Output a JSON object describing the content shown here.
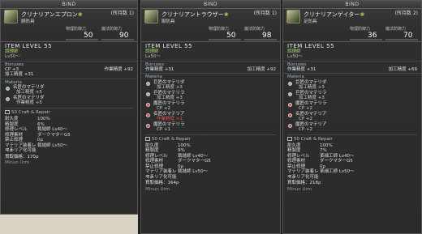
{
  "panels": [
    {
      "bind": "BIND",
      "name": "クリナリアンエプロン",
      "hq_mark": "❀",
      "owned": "(所持数 1)",
      "category": "胴防具",
      "stats": [
        {
          "label": "物理防御力",
          "value": "50"
        },
        {
          "label": "魔法防御力",
          "value": "90"
        }
      ],
      "item_level": "ITEM LEVEL 55",
      "job": "調理師",
      "level": "Lv50～",
      "bonuses_title": "Bonuses",
      "bonuses": [
        [
          "CP +3",
          "作業精度 +92"
        ],
        [
          "加工精度 +31",
          ""
        ]
      ],
      "materia_title": "Materia",
      "materia": [
        {
          "name": "名匠のマテリダ",
          "effect": "加工精度 +5",
          "color": "green",
          "bad": false
        },
        {
          "name": "名匠のマテリダ",
          "effect": "作業精度 +5",
          "color": "green",
          "bad": false
        }
      ],
      "craft": "50 Craft & Repair",
      "details": [
        [
          "耐久度",
          "100%"
        ],
        [
          "精製度",
          "6%"
        ],
        [
          "修理レベル",
          "裁縫師 Lv40～"
        ],
        [
          "修理素材",
          "ダークマターG5"
        ],
        [
          "禁止修理",
          "0ρ"
        ],
        [
          "マテリア装着レベル",
          "裁縫師 Lv50～"
        ],
        [
          "マテリア化可能",
          ""
        ]
      ],
      "sell": "買取価格：170ρ",
      "maker": "Minun Urm"
    },
    {
      "bind": "BIND",
      "name": "クリナリアントラウザー",
      "hq_mark": "❀",
      "owned": "(所持数 1)",
      "category": "脚防具",
      "stats": [
        {
          "label": "物理防御力",
          "value": "50"
        },
        {
          "label": "魔法防御力",
          "value": "98"
        }
      ],
      "item_level": "ITEM LEVEL 55",
      "job": "調理師",
      "level": "Lv50～",
      "bonuses_title": "Bonuses",
      "bonuses": [
        [
          "作業精度 +31",
          "加工精度 +92"
        ]
      ],
      "materia_title": "Materia",
      "materia": [
        {
          "name": "巨匠のマテリダ",
          "effect": "加工精度 +3",
          "color": "green",
          "bad": false
        },
        {
          "name": "巨匠のマテリラ",
          "effect": "加工精度 +3",
          "color": "green",
          "bad": false
        },
        {
          "name": "魔匠のマテリラ",
          "effect": "CP +2",
          "color": "red",
          "bad": false
        },
        {
          "name": "名匠のマテリア",
          "effect": "作業精度 +1",
          "color": "red",
          "bad": true
        },
        {
          "name": "魔匠のマテリラ",
          "effect": "CP +1",
          "color": "red",
          "bad": false
        }
      ],
      "craft": "50 Craft & Repair",
      "details": [
        [
          "耐久度",
          "100%"
        ],
        [
          "精製度",
          "9%"
        ],
        [
          "修理レベル",
          "裁縫師 Lv40～"
        ],
        [
          "修理素材",
          "ダークマターG5"
        ],
        [
          "禁止修理",
          "0ρ"
        ],
        [
          "マテリア装着レベル",
          "裁縫師 Lv50～"
        ],
        [
          "マテリア化可能",
          ""
        ]
      ],
      "sell": "買取価格：164ρ",
      "maker": "Minun Urm"
    },
    {
      "bind": "BIND",
      "name": "クリナリアンゲイター",
      "hq_mark": "❀",
      "owned": "(所持数 2)",
      "category": "足防具",
      "stats": [
        {
          "label": "物理防御力",
          "value": "36"
        },
        {
          "label": "魔法防御力",
          "value": "70"
        }
      ],
      "item_level": "ITEM LEVEL 55",
      "job": "調理師",
      "level": "Lv50～",
      "bonuses_title": "Bonuses",
      "bonuses": [
        [
          "作業精度 +31",
          "加工精度 +69"
        ]
      ],
      "materia_title": "Materia",
      "materia": [
        {
          "name": "巨匠のマテリダ",
          "effect": "加工精度 +3",
          "color": "green",
          "bad": false
        },
        {
          "name": "巨匠のマテリラ",
          "effect": "加工精度 +3",
          "color": "green",
          "bad": false
        },
        {
          "name": "魔匠のマテリラ",
          "effect": "CP +2",
          "color": "red",
          "bad": false
        },
        {
          "name": "名匠のマテリア",
          "effect": "CP +2",
          "color": "red",
          "bad": false
        },
        {
          "name": "魔匠のマテリア",
          "effect": "CP +2",
          "color": "red",
          "bad": false
        }
      ],
      "craft": "50 Craft & Repair",
      "details": [
        [
          "耐久度",
          "100%"
        ],
        [
          "精製度",
          "7%"
        ],
        [
          "修理レベル",
          "革細工師 Lv40～"
        ],
        [
          "修理素材",
          "ダークマターG5"
        ],
        [
          "禁止修理",
          "0ρ"
        ],
        [
          "マテリア装着レベル",
          "革細工師 Lv50～"
        ],
        [
          "マテリア化可能",
          ""
        ]
      ],
      "sell": "買取価格：218ρ",
      "maker": "Minun Urm"
    }
  ]
}
